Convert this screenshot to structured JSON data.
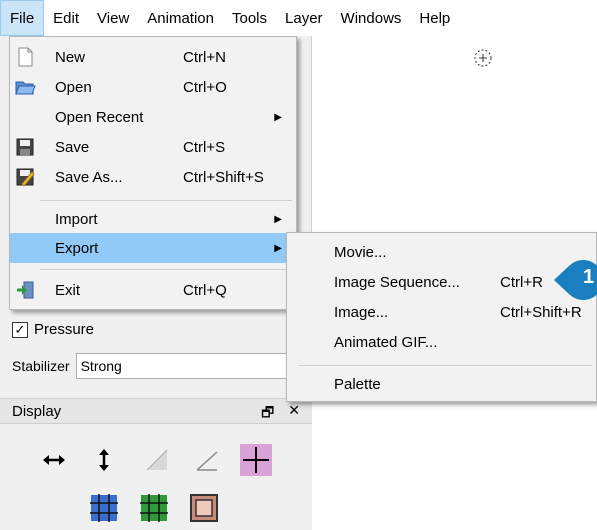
{
  "menubar": {
    "items": [
      {
        "label": "File",
        "active": true
      },
      {
        "label": "Edit"
      },
      {
        "label": "View"
      },
      {
        "label": "Animation"
      },
      {
        "label": "Tools"
      },
      {
        "label": "Layer"
      },
      {
        "label": "Windows"
      },
      {
        "label": "Help"
      }
    ]
  },
  "file_menu": {
    "items": [
      {
        "label": "New",
        "shortcut": "Ctrl+N",
        "icon": "new-file-icon"
      },
      {
        "label": "Open",
        "shortcut": "Ctrl+O",
        "icon": "open-folder-icon"
      },
      {
        "label": "Open Recent",
        "shortcut": "",
        "submenu": true
      },
      {
        "label": "Save",
        "shortcut": "Ctrl+S",
        "icon": "save-icon"
      },
      {
        "label": "Save As...",
        "shortcut": "Ctrl+Shift+S",
        "icon": "save-as-icon"
      },
      {
        "label": "Import",
        "shortcut": "",
        "submenu": true
      },
      {
        "label": "Export",
        "shortcut": "",
        "submenu": true,
        "highlighted": true
      },
      {
        "label": "Exit",
        "shortcut": "Ctrl+Q",
        "icon": "exit-icon"
      }
    ]
  },
  "export_menu": {
    "items": [
      {
        "label": "Movie...",
        "shortcut": ""
      },
      {
        "label": "Image Sequence...",
        "shortcut": "Ctrl+R"
      },
      {
        "label": "Image...",
        "shortcut": "Ctrl+Shift+R"
      },
      {
        "label": "Animated GIF...",
        "shortcut": ""
      },
      {
        "label": "Palette",
        "shortcut": ""
      }
    ]
  },
  "tool_options": {
    "pressure_label": "Pressure",
    "pressure_checked": true,
    "stabilizer_label": "Stabilizer",
    "stabilizer_value": "Strong"
  },
  "display_panel": {
    "title": "Display"
  },
  "callout": {
    "number": "1",
    "color": "#1a7fc1"
  },
  "colors": {
    "highlight": "#91c9f7",
    "menu_bg": "#f2f2f2",
    "active_menubar": "#cce4f7"
  }
}
